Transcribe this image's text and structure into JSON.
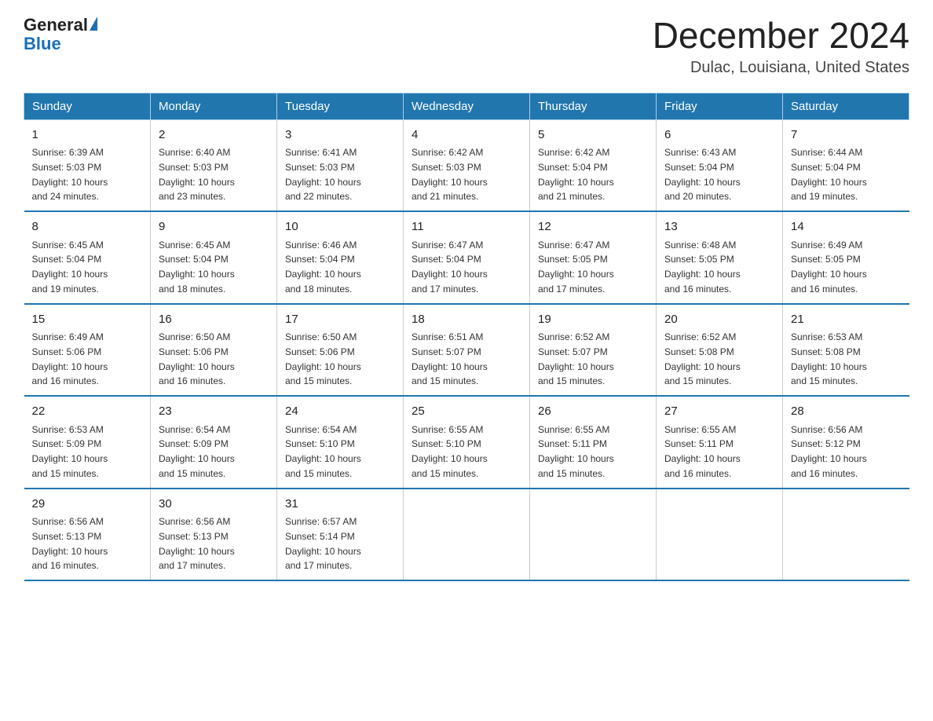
{
  "logo": {
    "text_general": "General",
    "text_blue": "Blue",
    "alt": "GeneralBlue logo"
  },
  "title": "December 2024",
  "location": "Dulac, Louisiana, United States",
  "days_of_week": [
    "Sunday",
    "Monday",
    "Tuesday",
    "Wednesday",
    "Thursday",
    "Friday",
    "Saturday"
  ],
  "weeks": [
    [
      {
        "day": "1",
        "sunrise": "6:39 AM",
        "sunset": "5:03 PM",
        "daylight": "10 hours and 24 minutes."
      },
      {
        "day": "2",
        "sunrise": "6:40 AM",
        "sunset": "5:03 PM",
        "daylight": "10 hours and 23 minutes."
      },
      {
        "day": "3",
        "sunrise": "6:41 AM",
        "sunset": "5:03 PM",
        "daylight": "10 hours and 22 minutes."
      },
      {
        "day": "4",
        "sunrise": "6:42 AM",
        "sunset": "5:03 PM",
        "daylight": "10 hours and 21 minutes."
      },
      {
        "day": "5",
        "sunrise": "6:42 AM",
        "sunset": "5:04 PM",
        "daylight": "10 hours and 21 minutes."
      },
      {
        "day": "6",
        "sunrise": "6:43 AM",
        "sunset": "5:04 PM",
        "daylight": "10 hours and 20 minutes."
      },
      {
        "day": "7",
        "sunrise": "6:44 AM",
        "sunset": "5:04 PM",
        "daylight": "10 hours and 19 minutes."
      }
    ],
    [
      {
        "day": "8",
        "sunrise": "6:45 AM",
        "sunset": "5:04 PM",
        "daylight": "10 hours and 19 minutes."
      },
      {
        "day": "9",
        "sunrise": "6:45 AM",
        "sunset": "5:04 PM",
        "daylight": "10 hours and 18 minutes."
      },
      {
        "day": "10",
        "sunrise": "6:46 AM",
        "sunset": "5:04 PM",
        "daylight": "10 hours and 18 minutes."
      },
      {
        "day": "11",
        "sunrise": "6:47 AM",
        "sunset": "5:04 PM",
        "daylight": "10 hours and 17 minutes."
      },
      {
        "day": "12",
        "sunrise": "6:47 AM",
        "sunset": "5:05 PM",
        "daylight": "10 hours and 17 minutes."
      },
      {
        "day": "13",
        "sunrise": "6:48 AM",
        "sunset": "5:05 PM",
        "daylight": "10 hours and 16 minutes."
      },
      {
        "day": "14",
        "sunrise": "6:49 AM",
        "sunset": "5:05 PM",
        "daylight": "10 hours and 16 minutes."
      }
    ],
    [
      {
        "day": "15",
        "sunrise": "6:49 AM",
        "sunset": "5:06 PM",
        "daylight": "10 hours and 16 minutes."
      },
      {
        "day": "16",
        "sunrise": "6:50 AM",
        "sunset": "5:06 PM",
        "daylight": "10 hours and 16 minutes."
      },
      {
        "day": "17",
        "sunrise": "6:50 AM",
        "sunset": "5:06 PM",
        "daylight": "10 hours and 15 minutes."
      },
      {
        "day": "18",
        "sunrise": "6:51 AM",
        "sunset": "5:07 PM",
        "daylight": "10 hours and 15 minutes."
      },
      {
        "day": "19",
        "sunrise": "6:52 AM",
        "sunset": "5:07 PM",
        "daylight": "10 hours and 15 minutes."
      },
      {
        "day": "20",
        "sunrise": "6:52 AM",
        "sunset": "5:08 PM",
        "daylight": "10 hours and 15 minutes."
      },
      {
        "day": "21",
        "sunrise": "6:53 AM",
        "sunset": "5:08 PM",
        "daylight": "10 hours and 15 minutes."
      }
    ],
    [
      {
        "day": "22",
        "sunrise": "6:53 AM",
        "sunset": "5:09 PM",
        "daylight": "10 hours and 15 minutes."
      },
      {
        "day": "23",
        "sunrise": "6:54 AM",
        "sunset": "5:09 PM",
        "daylight": "10 hours and 15 minutes."
      },
      {
        "day": "24",
        "sunrise": "6:54 AM",
        "sunset": "5:10 PM",
        "daylight": "10 hours and 15 minutes."
      },
      {
        "day": "25",
        "sunrise": "6:55 AM",
        "sunset": "5:10 PM",
        "daylight": "10 hours and 15 minutes."
      },
      {
        "day": "26",
        "sunrise": "6:55 AM",
        "sunset": "5:11 PM",
        "daylight": "10 hours and 15 minutes."
      },
      {
        "day": "27",
        "sunrise": "6:55 AM",
        "sunset": "5:11 PM",
        "daylight": "10 hours and 16 minutes."
      },
      {
        "day": "28",
        "sunrise": "6:56 AM",
        "sunset": "5:12 PM",
        "daylight": "10 hours and 16 minutes."
      }
    ],
    [
      {
        "day": "29",
        "sunrise": "6:56 AM",
        "sunset": "5:13 PM",
        "daylight": "10 hours and 16 minutes."
      },
      {
        "day": "30",
        "sunrise": "6:56 AM",
        "sunset": "5:13 PM",
        "daylight": "10 hours and 17 minutes."
      },
      {
        "day": "31",
        "sunrise": "6:57 AM",
        "sunset": "5:14 PM",
        "daylight": "10 hours and 17 minutes."
      },
      null,
      null,
      null,
      null
    ]
  ],
  "labels": {
    "sunrise": "Sunrise:",
    "sunset": "Sunset:",
    "daylight": "Daylight:"
  }
}
